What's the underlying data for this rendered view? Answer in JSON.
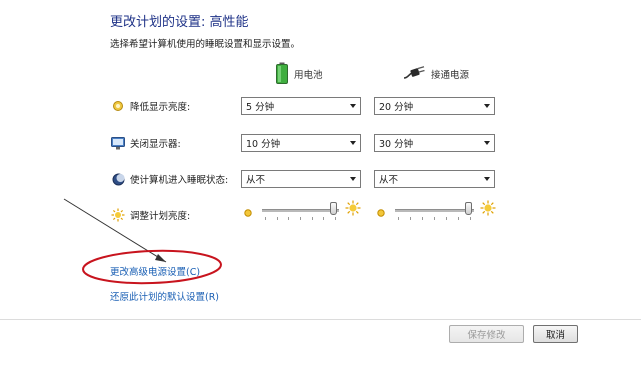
{
  "header": {
    "title": "更改计划的设置: 高性能",
    "subtitle": "选择希望计算机使用的睡眠设置和显示设置。"
  },
  "columns": {
    "battery": {
      "label": "用电池",
      "icon": "battery-icon"
    },
    "plugged": {
      "label": "接通电源",
      "icon": "power-plug-icon"
    }
  },
  "settings": [
    {
      "label": "降低显示亮度:",
      "icon": "dim-display-icon",
      "battery": "5 分钟",
      "plugged": "20 分钟"
    },
    {
      "label": "关闭显示器:",
      "icon": "monitor-icon",
      "battery": "10 分钟",
      "plugged": "30 分钟"
    },
    {
      "label": "使计算机进入睡眠状态:",
      "icon": "sleep-moon-icon",
      "battery": "从不",
      "plugged": "从不"
    }
  ],
  "brightness": {
    "label": "调整计划亮度:",
    "icon": "brightness-sun-icon",
    "battery_level": 0.93,
    "plugged_level": 0.93
  },
  "links": {
    "advanced": "更改高级电源设置(C)",
    "restore": "还原此计划的默认设置(R)"
  },
  "buttons": {
    "save": "保存修改",
    "cancel": "取消"
  },
  "colors": {
    "title": "#1e3287",
    "link": "#1a5fb4",
    "annotation": "#c8141e"
  }
}
